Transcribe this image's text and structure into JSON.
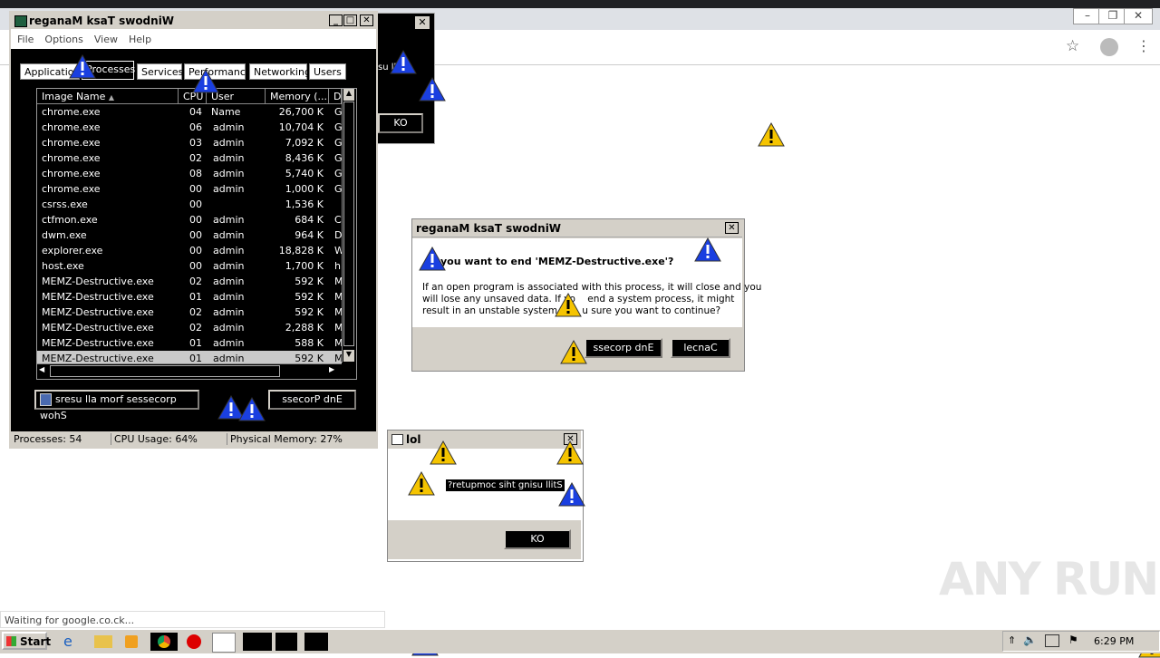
{
  "browser": {
    "status_text": "Waiting for google.co.ck..."
  },
  "task_manager": {
    "title": "reganaM ksaT swodniW",
    "menu": [
      "File",
      "Options",
      "View",
      "Help"
    ],
    "tabs": [
      "Applications",
      "Processes",
      "Services",
      "Performance",
      "Networking",
      "Users"
    ],
    "columns": [
      "Image Name",
      "CPU",
      "User Name",
      "Memory (...",
      "D"
    ],
    "rows": [
      {
        "name": "chrome.exe",
        "cpu": "04",
        "user": "",
        "mem": "26,700 K",
        "d": "G"
      },
      {
        "name": "chrome.exe",
        "cpu": "06",
        "user": "admin",
        "mem": "10,704 K",
        "d": "G"
      },
      {
        "name": "chrome.exe",
        "cpu": "03",
        "user": "admin",
        "mem": "7,092 K",
        "d": "G"
      },
      {
        "name": "chrome.exe",
        "cpu": "02",
        "user": "admin",
        "mem": "8,436 K",
        "d": "G"
      },
      {
        "name": "chrome.exe",
        "cpu": "08",
        "user": "admin",
        "mem": "5,740 K",
        "d": "G"
      },
      {
        "name": "chrome.exe",
        "cpu": "00",
        "user": "admin",
        "mem": "1,000 K",
        "d": "G"
      },
      {
        "name": "csrss.exe",
        "cpu": "00",
        "user": "",
        "mem": "1,536 K",
        "d": ""
      },
      {
        "name": "ctfmon.exe",
        "cpu": "00",
        "user": "admin",
        "mem": "684 K",
        "d": "C"
      },
      {
        "name": "dwm.exe",
        "cpu": "00",
        "user": "admin",
        "mem": "964 K",
        "d": "D"
      },
      {
        "name": "explorer.exe",
        "cpu": "00",
        "user": "admin",
        "mem": "18,828 K",
        "d": "W"
      },
      {
        "name": "host.exe",
        "cpu": "00",
        "user": "admin",
        "mem": "1,700 K",
        "d": "h"
      },
      {
        "name": "MEMZ-Destructive.exe",
        "cpu": "02",
        "user": "admin",
        "mem": "592 K",
        "d": "M"
      },
      {
        "name": "MEMZ-Destructive.exe",
        "cpu": "01",
        "user": "admin",
        "mem": "592 K",
        "d": "M"
      },
      {
        "name": "MEMZ-Destructive.exe",
        "cpu": "02",
        "user": "admin",
        "mem": "592 K",
        "d": "M"
      },
      {
        "name": "MEMZ-Destructive.exe",
        "cpu": "02",
        "user": "admin",
        "mem": "2,288 K",
        "d": "M"
      },
      {
        "name": "MEMZ-Destructive.exe",
        "cpu": "01",
        "user": "admin",
        "mem": "588 K",
        "d": "M"
      },
      {
        "name": "MEMZ-Destructive.exe",
        "cpu": "01",
        "user": "admin",
        "mem": "592 K",
        "d": "M"
      }
    ],
    "show_all_button": "sresu lla morf sessecorp wohS",
    "end_process_button": "ssecorP dnE",
    "status": {
      "processes": "Processes: 54",
      "cpu": "CPU Usage: 64%",
      "memory": "Physical Memory: 27%"
    }
  },
  "behind_window": {
    "text": "su llitS",
    "ok": "KO"
  },
  "confirm_dialog": {
    "title": "reganaM ksaT swodniW",
    "heading": "you want to end 'MEMZ-Destructive.exe'?",
    "body_line1": "If an open program is associated with this process, it will close and you",
    "body_line2": "will lose any unsaved data. If yo    end a system process, it might",
    "body_line3": "result in an unstable system. A    u sure you want to continue?",
    "end_button": "ssecorp dnE",
    "cancel_button": "lecnaC"
  },
  "lol_dialog": {
    "title": "lol",
    "message": "?retupmoc siht gnisu llitS",
    "ok": "KO"
  },
  "taskbar": {
    "start": "Start",
    "time": "6:29 PM"
  },
  "watermark": "ANY RUN"
}
